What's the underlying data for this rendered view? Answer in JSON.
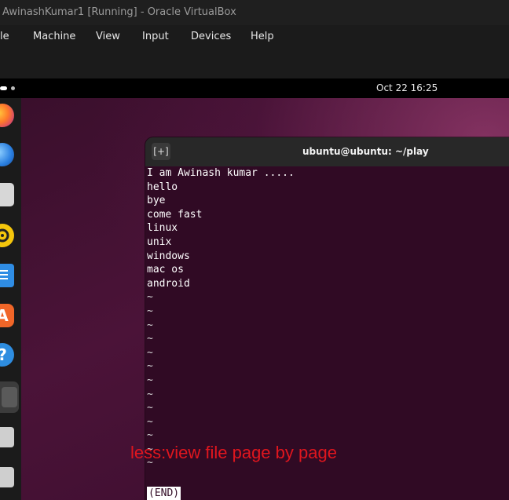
{
  "vbox": {
    "title": "AwinashKumar1 [Running] - Oracle VirtualBox",
    "menu": [
      "le",
      "Machine",
      "View",
      "Input",
      "Devices",
      "Help"
    ]
  },
  "topbar": {
    "clock": "Oct 22  16:25"
  },
  "dock": {
    "icons": [
      "firefox-icon",
      "thunderbird-icon",
      "files-icon",
      "rhythmbox-icon",
      "writer-icon",
      "software-icon",
      "help-icon",
      "terminal-icon",
      "drive-icon",
      "drive-icon"
    ]
  },
  "terminal": {
    "title": "ubuntu@ubuntu: ~/play",
    "newtab_glyph": "[+]",
    "lines": [
      "I am Awinash kumar .....",
      "hello",
      "bye",
      "come fast",
      "linux",
      "unix",
      "windows",
      "mac os",
      "android"
    ],
    "tildes": [
      "~",
      "~",
      "~",
      "~",
      "~",
      "~",
      "~",
      "~",
      "~",
      "~",
      "~",
      "~",
      "~"
    ],
    "end_marker": "(END)"
  },
  "caption": "less:view file page by page",
  "colors": {
    "caption": "#e0161e",
    "terminal_bg": "#300a24"
  }
}
